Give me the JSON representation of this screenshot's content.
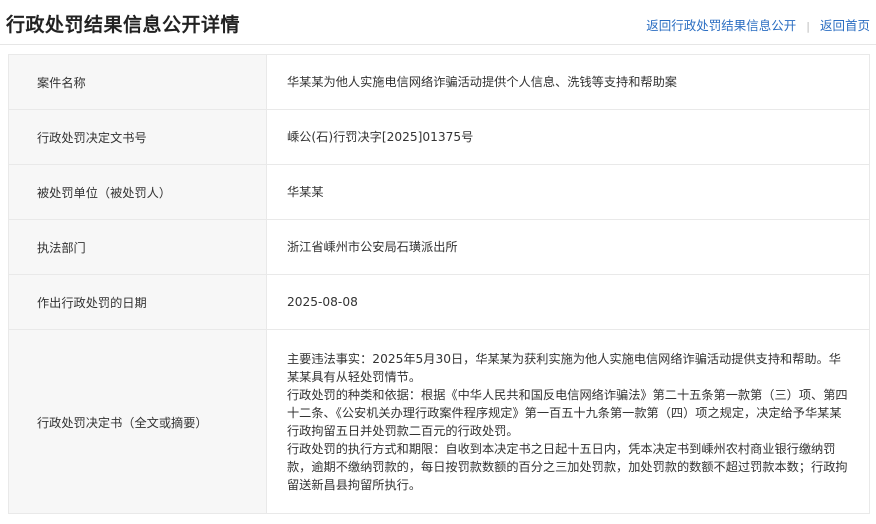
{
  "header": {
    "title": "行政处罚结果信息公开详情",
    "link_back_list": "返回行政处罚结果信息公开",
    "separator": "|",
    "link_home": "返回首页"
  },
  "rows": [
    {
      "label": "案件名称",
      "value": "华某某为他人实施电信网络诈骗活动提供个人信息、洗钱等支持和帮助案"
    },
    {
      "label": "行政处罚决定文书号",
      "value": "嵊公(石)行罚决字[2025]01375号"
    },
    {
      "label": "被处罚单位（被处罚人）",
      "value": "华某某"
    },
    {
      "label": "执法部门",
      "value": "浙江省嵊州市公安局石璜派出所"
    },
    {
      "label": "作出行政处罚的日期",
      "value": "2025-08-08"
    }
  ],
  "decision": {
    "label": "行政处罚决定书（全文或摘要）",
    "paragraphs": [
      "主要违法事实：2025年5月30日，华某某为获利实施为他人实施电信网络诈骗活动提供支持和帮助。华某某具有从轻处罚情节。",
      "行政处罚的种类和依据：根据《中华人民共和国反电信网络诈骗法》第二十五条第一款第（三）项、第四十二条、《公安机关办理行政案件程序规定》第一百五十九条第一款第（四）项之规定，决定给予华某某行政拘留五日并处罚款二百元的行政处罚。",
      "行政处罚的执行方式和期限：自收到本决定书之日起十五日内，凭本决定书到嵊州农村商业银行缴纳罚款，逾期不缴纳罚款的，每日按罚款数额的百分之三加处罚款，加处罚款的数额不超过罚款本数；行政拘留送新昌县拘留所执行。"
    ]
  }
}
